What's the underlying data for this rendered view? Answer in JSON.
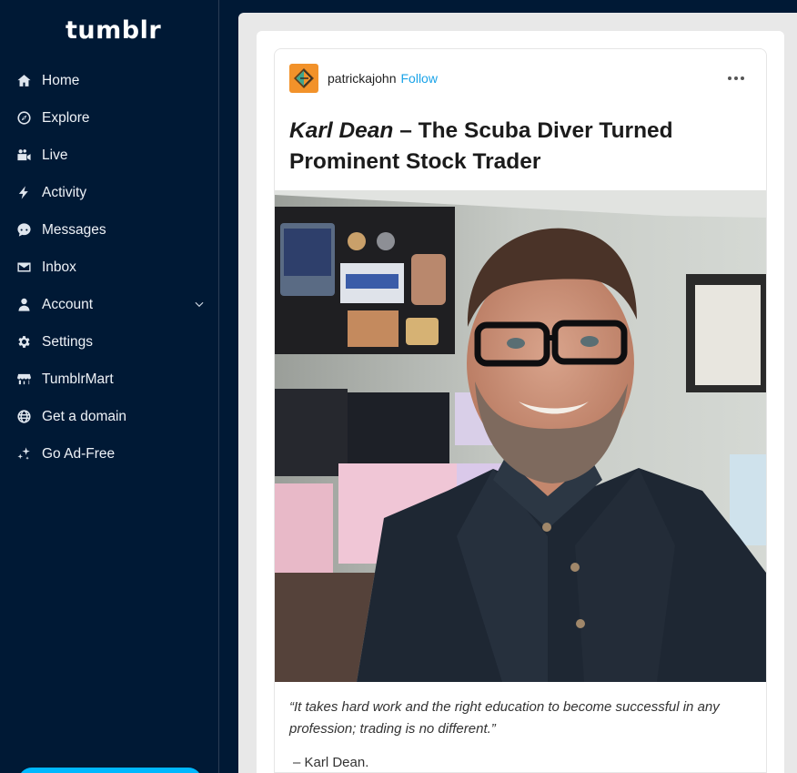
{
  "app": {
    "logo": "tumblr"
  },
  "sidebar": {
    "items": [
      {
        "label": "Home",
        "icon": "home-icon"
      },
      {
        "label": "Explore",
        "icon": "compass-icon"
      },
      {
        "label": "Live",
        "icon": "video-camera-icon"
      },
      {
        "label": "Activity",
        "icon": "lightning-icon"
      },
      {
        "label": "Messages",
        "icon": "chat-bubble-icon"
      },
      {
        "label": "Inbox",
        "icon": "envelope-icon"
      },
      {
        "label": "Account",
        "icon": "person-icon"
      },
      {
        "label": "Settings",
        "icon": "gear-icon"
      },
      {
        "label": "TumblrMart",
        "icon": "storefront-icon"
      },
      {
        "label": "Get a domain",
        "icon": "globe-icon"
      },
      {
        "label": "Go Ad-Free",
        "icon": "sparkles-icon"
      }
    ]
  },
  "post": {
    "username": "patrickajohn",
    "follow_label": "Follow",
    "title_italic": "Karl Dean",
    "title_rest": " – The Scuba Diver Turned Prominent Stock Trader",
    "quote": "“It takes hard work and the right education to become successful in any profession; trading is no different.”",
    "attribution": " – Karl Dean."
  },
  "colors": {
    "sidebar_bg": "#001935",
    "accent": "#00b8ff",
    "follow": "#1aa3e8"
  }
}
